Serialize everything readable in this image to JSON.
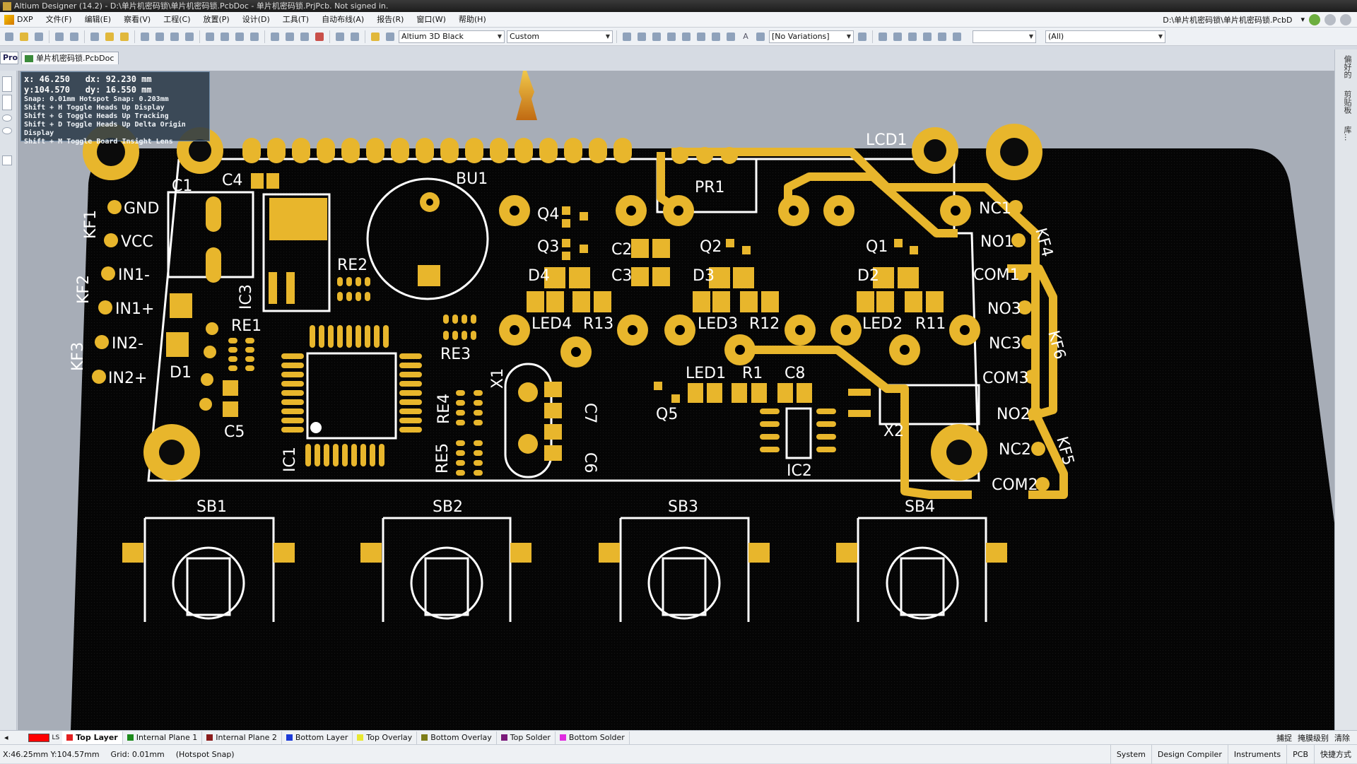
{
  "window": {
    "title": "Altium Designer (14.2) - D:\\单片机密码锁\\单片机密码锁.PcbDoc - 单片机密码锁.PrjPcb. Not signed in."
  },
  "menus": [
    "DXP",
    "文件(F)",
    "编辑(E)",
    "察看(V)",
    "工程(C)",
    "放置(P)",
    "设计(D)",
    "工具(T)",
    "自动布线(A)",
    "报告(R)",
    "窗口(W)",
    "帮助(H)"
  ],
  "doc_path": "D:\\单片机密码锁\\单片机密码锁.PcbD",
  "toolbar": {
    "view_config": "Altium 3D Black",
    "view_custom": "Custom",
    "variations": "[No Variations]",
    "filter": "(All)"
  },
  "tabs": {
    "project_tab": "Pro",
    "doc_tab": "单片机密码锁.PcbDoc"
  },
  "hud": {
    "line1": "x: 46.250   dx: 92.230 mm",
    "line2": "y:104.570   dy: 16.550 mm",
    "line3": "Snap: 0.01mm Hotspot Snap: 0.203mm",
    "line4": "Shift + H  Toggle Heads Up Display",
    "line5": "Shift + G  Toggle Heads Up Tracking",
    "line6": "Shift + D  Toggle Heads Up Delta Origin Display",
    "line7": "Shift + M  Toggle Board Insight Lens"
  },
  "right_panels": [
    "偏好的",
    "剪贴板",
    "库..."
  ],
  "board_labels": {
    "c1": "C1",
    "c4": "C4",
    "kf1": "KF1",
    "kf2": "KF2",
    "kf3": "KF3",
    "gnd": "GND",
    "vcc": "VCC",
    "in1m": "IN1-",
    "in1p": "IN1+",
    "in2m": "IN2-",
    "in2p": "IN2+",
    "bu1": "BU1",
    "re2": "RE2",
    "ic3": "IC3",
    "re1": "RE1",
    "d1": "D1",
    "c5": "C5",
    "re3": "RE3",
    "ic1": "IC1",
    "re4": "RE4",
    "re5": "RE5",
    "x1": "X1",
    "c7": "C7",
    "c6": "C6",
    "q4": "Q4",
    "q3": "Q3",
    "d4": "D4",
    "led4": "LED4",
    "r13": "R13",
    "c2": "C2",
    "c3": "C3",
    "q2": "Q2",
    "d3": "D3",
    "led3": "LED3",
    "r12": "R12",
    "pr1": "PR1",
    "lcd1": "LCD1",
    "q1": "Q1",
    "d2": "D2",
    "led2": "LED2",
    "r11": "R11",
    "nc1": "NC1",
    "no1": "NO1",
    "com1": "COM1",
    "no3": "NO3",
    "nc3": "NC3",
    "com3": "COM3",
    "no2": "NO2",
    "nc2": "NC2",
    "com2": "COM2",
    "kf4": "KF4",
    "kf5": "KF5",
    "kf6": "KF6",
    "led1": "LED1",
    "r1": "R1",
    "c8": "C8",
    "q5": "Q5",
    "ic2": "IC2",
    "x2": "X2",
    "sb1": "SB1",
    "sb2": "SB2",
    "sb3": "SB3",
    "sb4": "SB4"
  },
  "layers": [
    {
      "name": "Top Layer",
      "color": "#e32020"
    },
    {
      "name": "Internal Plane 1",
      "color": "#1c8a1c"
    },
    {
      "name": "Internal Plane 2",
      "color": "#8a1c1c"
    },
    {
      "name": "Bottom Layer",
      "color": "#1c3ad8"
    },
    {
      "name": "Top Overlay",
      "color": "#e8e830"
    },
    {
      "name": "Bottom Overlay",
      "color": "#7d7d18"
    },
    {
      "name": "Top Solder",
      "color": "#7a1a7a"
    },
    {
      "name": "Bottom Solder",
      "color": "#e02ce0"
    }
  ],
  "layer_ls": "LS",
  "layerbar_right": [
    "捕捉",
    "掩膜级别",
    "清除"
  ],
  "status": {
    "coords": "X:46.25mm Y:104.57mm",
    "grid": "Grid: 0.01mm",
    "snap": "(Hotspot Snap)",
    "buttons": [
      "System",
      "Design Compiler",
      "Instruments",
      "PCB",
      "快捷方式"
    ]
  },
  "colors": {
    "board": "#050505",
    "copper": "#e8b62c",
    "silk": "#ffffff",
    "background": "#a7adb7"
  }
}
